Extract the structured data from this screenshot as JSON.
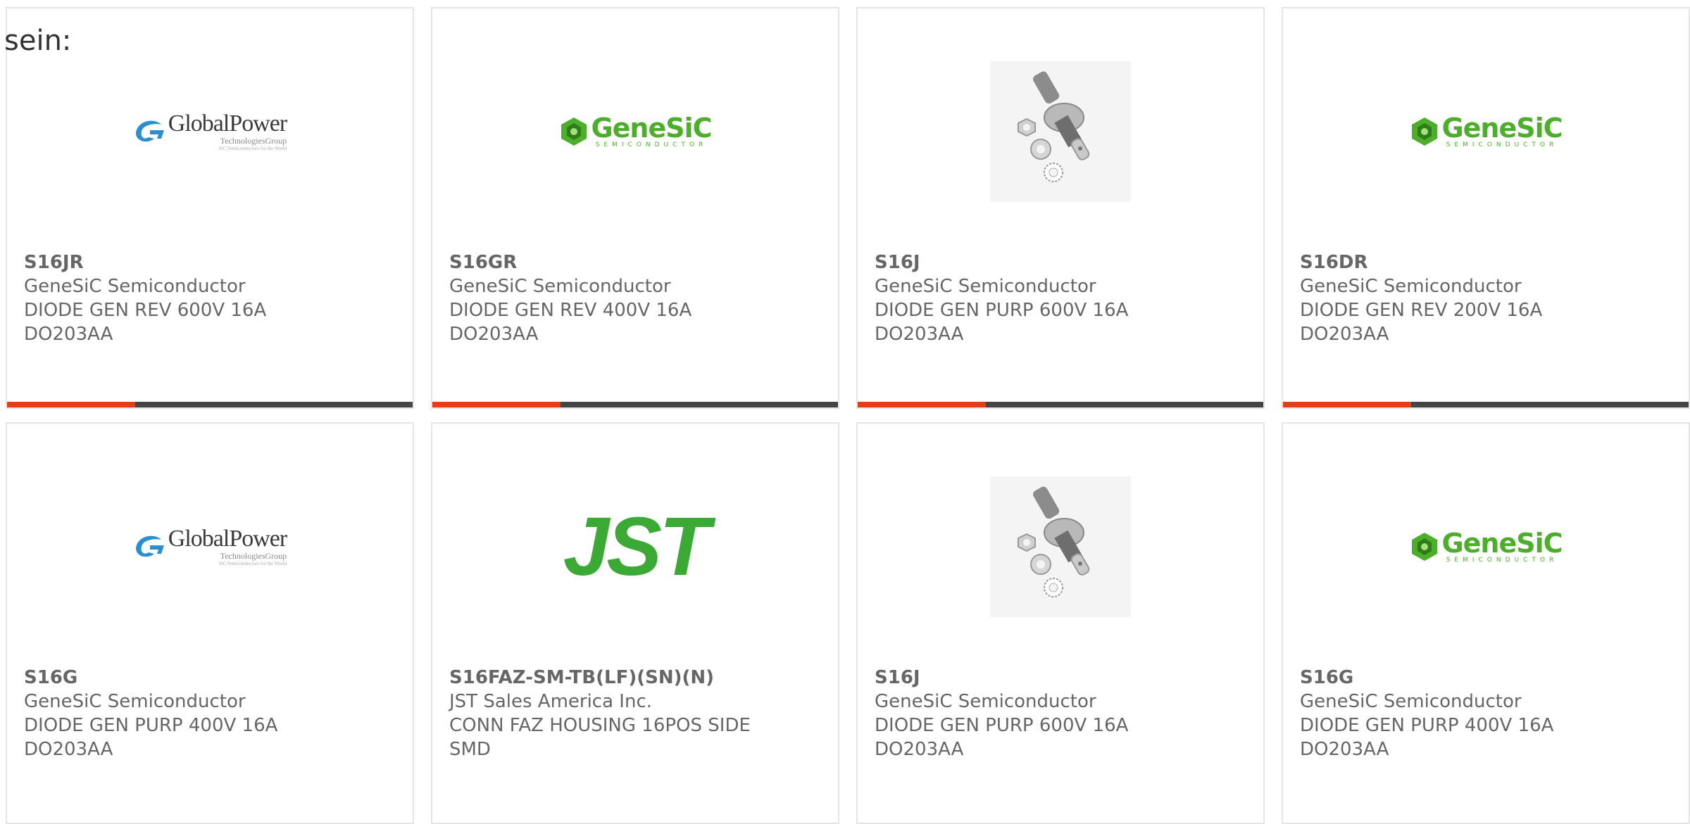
{
  "intro_text": "sein:",
  "brand_colors": {
    "accent": "#e63e14",
    "bar": "#444444",
    "text": "#666666",
    "border": "#e5e5e5"
  },
  "products": [
    {
      "part": "S16JR",
      "manufacturer": "GeneSiC Semiconductor",
      "desc1": "DIODE GEN REV 600V 16A",
      "desc2": "DO203AA",
      "image": "globalpower-logo",
      "logo_name": "GlobalPower",
      "logo_sub": "TechnologiesGroup",
      "logo_tag": "SiC Semiconductors for the World"
    },
    {
      "part": "S16GR",
      "manufacturer": "GeneSiC Semiconductor",
      "desc1": "DIODE GEN REV 400V 16A",
      "desc2": "DO203AA",
      "image": "genesic-logo",
      "logo_name": "GeneSiC",
      "logo_sub": "SEMICONDUCTOR"
    },
    {
      "part": "S16J",
      "manufacturer": "GeneSiC Semiconductor",
      "desc1": "DIODE GEN PURP 600V 16A",
      "desc2": "DO203AA",
      "image": "stud-diode-photo"
    },
    {
      "part": "S16DR",
      "manufacturer": "GeneSiC Semiconductor",
      "desc1": "DIODE GEN REV 200V 16A",
      "desc2": "DO203AA",
      "image": "genesic-logo",
      "logo_name": "GeneSiC",
      "logo_sub": "SEMICONDUCTOR"
    },
    {
      "part": "S16G",
      "manufacturer": "GeneSiC Semiconductor",
      "desc1": "DIODE GEN PURP 400V 16A",
      "desc2": "DO203AA",
      "image": "globalpower-logo",
      "logo_name": "GlobalPower",
      "logo_sub": "TechnologiesGroup",
      "logo_tag": "SiC Semiconductors for the World"
    },
    {
      "part": "S16FAZ-SM-TB(LF)(SN)(N)",
      "manufacturer": "JST Sales America Inc.",
      "desc1": "CONN FAZ HOUSING 16POS SIDE",
      "desc2": "SMD",
      "image": "jst-logo",
      "logo_name": "JST"
    },
    {
      "part": "S16J",
      "manufacturer": "GeneSiC Semiconductor",
      "desc1": "DIODE GEN PURP 600V 16A",
      "desc2": "DO203AA",
      "image": "stud-diode-photo"
    },
    {
      "part": "S16G",
      "manufacturer": "GeneSiC Semiconductor",
      "desc1": "DIODE GEN PURP 400V 16A",
      "desc2": "DO203AA",
      "image": "genesic-logo",
      "logo_name": "GeneSiC",
      "logo_sub": "SEMICONDUCTOR"
    }
  ]
}
